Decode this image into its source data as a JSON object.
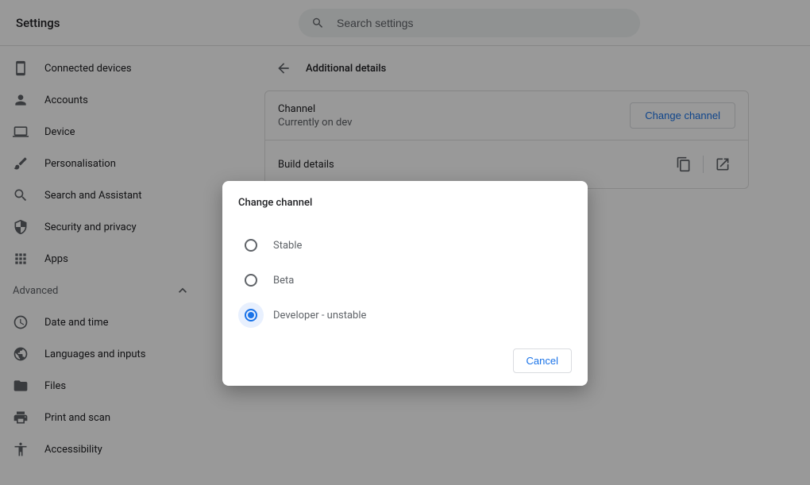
{
  "header": {
    "title": "Settings",
    "search_placeholder": "Search settings"
  },
  "sidebar": {
    "items": [
      {
        "label": "Connected devices",
        "icon": "device-icon"
      },
      {
        "label": "Accounts",
        "icon": "person-icon"
      },
      {
        "label": "Device",
        "icon": "laptop-icon"
      },
      {
        "label": "Personalisation",
        "icon": "brush-icon"
      },
      {
        "label": "Search and Assistant",
        "icon": "search-icon"
      },
      {
        "label": "Security and privacy",
        "icon": "shield-icon"
      },
      {
        "label": "Apps",
        "icon": "apps-icon"
      }
    ],
    "advanced_label": "Advanced",
    "advanced_items": [
      {
        "label": "Date and time",
        "icon": "clock-icon"
      },
      {
        "label": "Languages and inputs",
        "icon": "globe-icon"
      },
      {
        "label": "Files",
        "icon": "folder-icon"
      },
      {
        "label": "Print and scan",
        "icon": "printer-icon"
      },
      {
        "label": "Accessibility",
        "icon": "accessibility-icon"
      }
    ]
  },
  "page": {
    "title": "Additional details",
    "channel": {
      "label": "Channel",
      "value": "Currently on dev",
      "button": "Change channel"
    },
    "build": {
      "label": "Build details"
    }
  },
  "dialog": {
    "title": "Change channel",
    "options": [
      {
        "label": "Stable",
        "selected": false
      },
      {
        "label": "Beta",
        "selected": false
      },
      {
        "label": "Developer - unstable",
        "selected": true
      }
    ],
    "cancel": "Cancel"
  }
}
